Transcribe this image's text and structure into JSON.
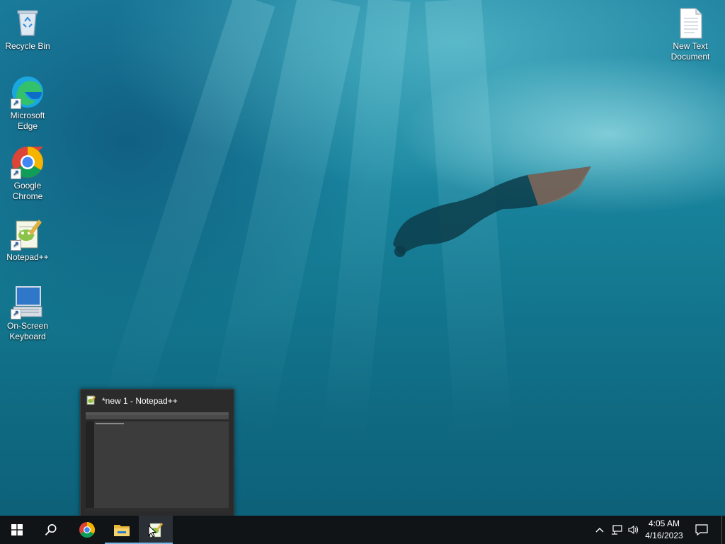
{
  "desktop": {
    "icons": [
      {
        "label_line1": "Recycle Bin",
        "label_line2": "",
        "icon": "recycle-bin-icon"
      },
      {
        "label_line1": "Microsoft",
        "label_line2": "Edge",
        "icon": "edge-icon"
      },
      {
        "label_line1": "Google",
        "label_line2": "Chrome",
        "icon": "chrome-icon"
      },
      {
        "label_line1": "Notepad++",
        "label_line2": "",
        "icon": "notepadpp-icon"
      },
      {
        "label_line1": "On-Screen",
        "label_line2": "Keyboard",
        "icon": "keyboard-icon"
      },
      {
        "label_line1": "New Text",
        "label_line2": "Document",
        "icon": "text-document-icon"
      }
    ]
  },
  "thumbnail": {
    "title": "*new 1 - Notepad++"
  },
  "taskbar": {
    "time": "4:05 AM",
    "date": "4/16/2023"
  },
  "colors": {
    "taskbar_bg": "#101417",
    "active_indicator": "#7ab8e8"
  }
}
